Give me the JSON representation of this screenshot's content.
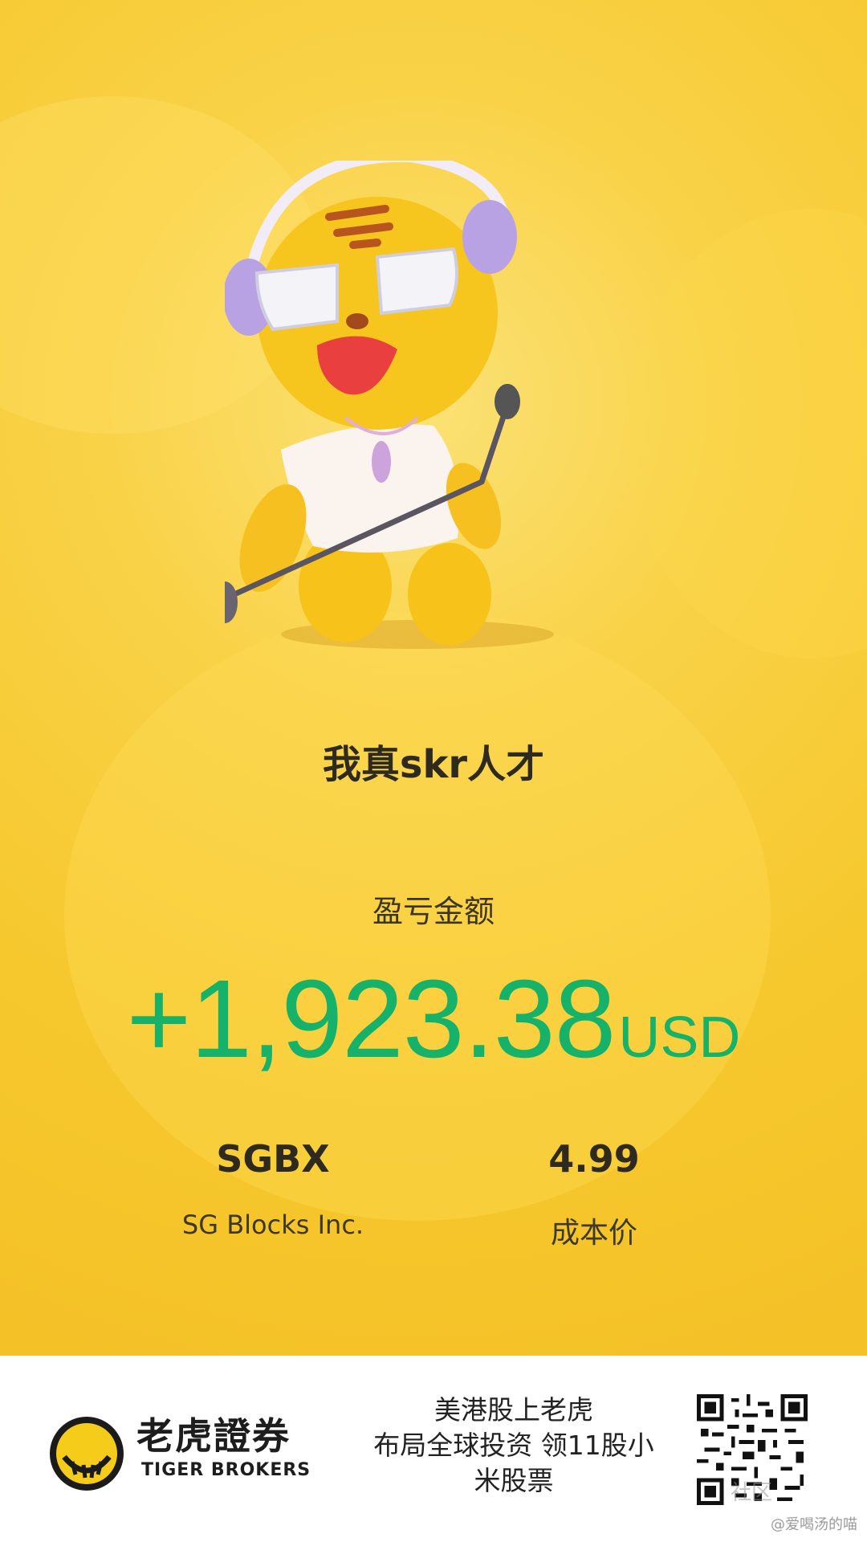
{
  "card": {
    "title": "我真skr人才",
    "pnl_label": "盈亏金额",
    "pnl_value": "+1,923.38",
    "pnl_currency": "USD",
    "symbol": "SGBX",
    "company": "SG Blocks Inc.",
    "cost_price": "4.99",
    "cost_label": "成本价"
  },
  "footer": {
    "brand_cn": "老虎證券",
    "brand_en": "TIGER BROKERS",
    "promo_line1": "美港股上老虎",
    "promo_line2": "布局全球投资 领11股小",
    "promo_line3": "米股票",
    "watermark_community": "社区",
    "watermark_user": "@爱喝汤的喵"
  },
  "colors": {
    "background": "#f6c82e",
    "profit": "#17b26a",
    "footer": "#ffffff"
  },
  "icons": {
    "mascot": "tiger-mascot-singer",
    "logo": "tiger-brokers-logo",
    "qr": "qr-code"
  }
}
